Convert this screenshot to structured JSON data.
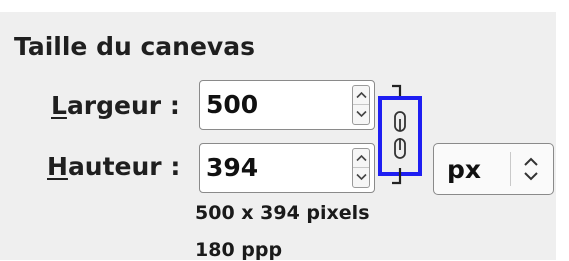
{
  "section": {
    "title": "Taille du canevas"
  },
  "width_field": {
    "mnemonic": "L",
    "label_rest": "argeur :",
    "value": "500"
  },
  "height_field": {
    "mnemonic": "H",
    "label_rest": "auteur :",
    "value": "394"
  },
  "chain": {
    "icon": "chain-link-icon",
    "highlight_color": "#1e1ef2"
  },
  "unit": {
    "selected": "px",
    "icon": "chevron-up-down-icon"
  },
  "info": {
    "size_text": "500 x 394 pixels",
    "resolution_text": "180 ppp"
  }
}
